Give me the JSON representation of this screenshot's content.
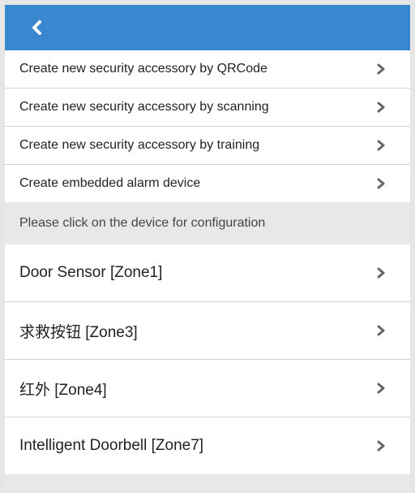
{
  "header": {
    "back_icon": "chevron-left-icon"
  },
  "menu": {
    "items": [
      {
        "label": "Create new security accessory by QRCode"
      },
      {
        "label": "Create new security accessory by scanning"
      },
      {
        "label": "Create new security accessory by training"
      },
      {
        "label": "Create embedded alarm device"
      }
    ]
  },
  "section": {
    "hint": "Please click on the device for configuration"
  },
  "devices": [
    {
      "label": "Door Sensor [Zone1]"
    },
    {
      "label": "求救按钮 [Zone3]"
    },
    {
      "label": "红外 [Zone4]"
    },
    {
      "label": "Intelligent Doorbell [Zone7]"
    }
  ],
  "colors": {
    "header": "#3a87cf",
    "section_bg": "#e8e8e8",
    "chevron": "#666666"
  }
}
